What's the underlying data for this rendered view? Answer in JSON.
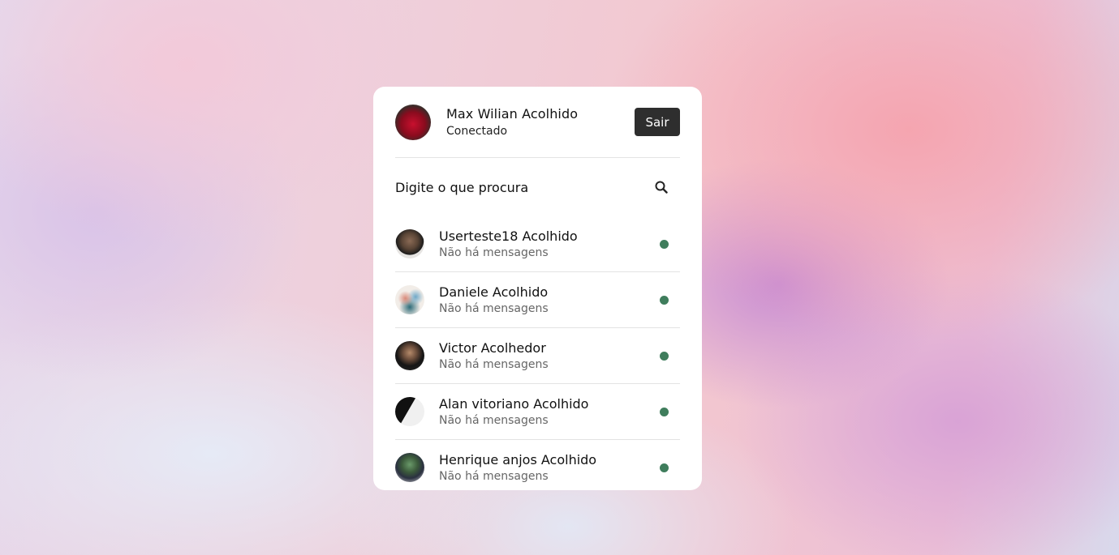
{
  "current_user": {
    "name": "Max Wilian Acolhido",
    "status": "Conectado",
    "logout_label": "Sair"
  },
  "search": {
    "placeholder": "Digite o que procura",
    "icon": "search-icon"
  },
  "contacts": [
    {
      "name": "Userteste18 Acolhido",
      "last_message": "Não há mensagens",
      "status": "online"
    },
    {
      "name": "Daniele Acolhido",
      "last_message": "Não há mensagens",
      "status": "online"
    },
    {
      "name": "Victor Acolhedor",
      "last_message": "Não há mensagens",
      "status": "online"
    },
    {
      "name": "Alan vitoriano Acolhido",
      "last_message": "Não há mensagens",
      "status": "online"
    },
    {
      "name": "Henrique anjos Acolhido",
      "last_message": "Não há mensagens",
      "status": "online"
    }
  ],
  "colors": {
    "online": "#3f7d5c",
    "button_bg": "#2e2e2e"
  }
}
